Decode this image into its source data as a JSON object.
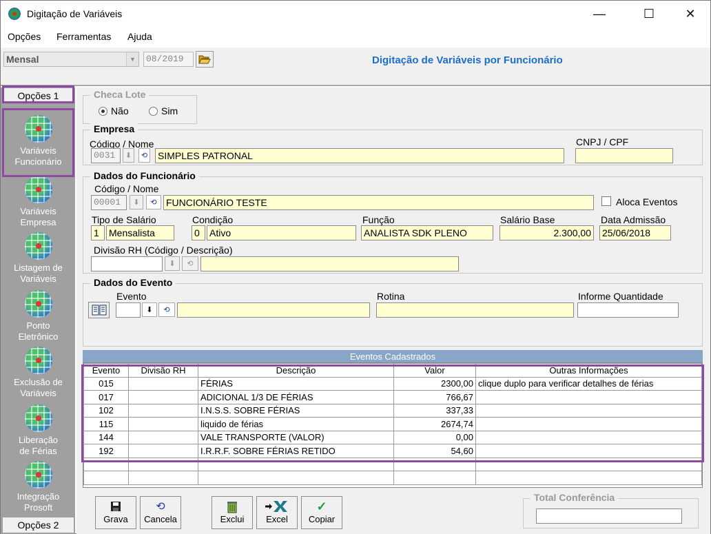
{
  "window": {
    "title": "Digitação de Variáveis",
    "minimize": "—",
    "maximize": "☐",
    "close": "✕"
  },
  "menu": [
    "Opções",
    "Ferramentas",
    "Ajuda"
  ],
  "toolbar": {
    "period": "Mensal",
    "date": "08/2019",
    "heading": "Digitação de Variáveis por Funcionário"
  },
  "sidebar": {
    "tab_top": "Opções 1",
    "tab_bottom": "Opções 2",
    "items": [
      {
        "l1": "Variáveis",
        "l2": "Funcionário"
      },
      {
        "l1": "Variáveis",
        "l2": "Empresa"
      },
      {
        "l1": "Listagem de",
        "l2": "Variáveis"
      },
      {
        "l1": "Ponto",
        "l2": "Eletrônico"
      },
      {
        "l1": "Exclusão de",
        "l2": "Variáveis"
      },
      {
        "l1": "Liberação",
        "l2": "de Férias"
      },
      {
        "l1": "Integração",
        "l2": "Prosoft"
      }
    ]
  },
  "checa_lote": {
    "title": "Checa Lote",
    "opt_nao": "Não",
    "opt_sim": "Sim"
  },
  "empresa": {
    "title": "Empresa",
    "codigo_label": "Código / Nome",
    "code": "0031",
    "name": "SIMPLES PATRONAL",
    "cnpj_label": "CNPJ / CPF",
    "cnpj": ""
  },
  "funcionario": {
    "title": "Dados do Funcionário",
    "codigo_label": "Código / Nome",
    "code": "00001",
    "name": "FUNCIONÁRIO TESTE",
    "aloca_label": "Aloca Eventos",
    "tipo_label": "Tipo de Salário",
    "tipo_code": "1",
    "tipo_text": "Mensalista",
    "cond_label": "Condição",
    "cond_code": "0",
    "cond_text": "Ativo",
    "funcao_label": "Função",
    "funcao": "ANALISTA SDK PLENO",
    "salario_label": "Salário Base",
    "salario": "2.300,00",
    "admissao_label": "Data Admissão",
    "admissao": "25/06/2018",
    "divisao_label": "Divisão RH (Código / Descrição)"
  },
  "evento": {
    "title": "Dados do Evento",
    "evento_label": "Evento",
    "rotina_label": "Rotina",
    "quantidade_label": "Informe Quantidade"
  },
  "grid": {
    "band": "Eventos Cadastrados",
    "headers": [
      "Evento",
      "Divisão RH",
      "Descrição",
      "Valor",
      "Outras Informações"
    ],
    "rows": [
      [
        "015",
        "",
        "FÉRIAS",
        "2300,00",
        "clique duplo para verificar detalhes de férias"
      ],
      [
        "017",
        "",
        "ADICIONAL 1/3 DE FÉRIAS",
        "766,67",
        ""
      ],
      [
        "102",
        "",
        "I.N.S.S. SOBRE FÉRIAS",
        "337,33",
        ""
      ],
      [
        "115",
        "",
        "liquido de férias",
        "2674,74",
        ""
      ],
      [
        "144",
        "",
        "VALE TRANSPORTE (VALOR)",
        "0,00",
        ""
      ],
      [
        "192",
        "",
        "I.R.R.F. SOBRE FÉRIAS RETIDO",
        "54,60",
        ""
      ]
    ]
  },
  "buttons": {
    "grava": "Grava",
    "cancela": "Cancela",
    "exclui": "Exclui",
    "excel": "Excel",
    "copiar": "Copiar"
  },
  "total": {
    "title": "Total Conferência",
    "value": ""
  },
  "colors": {
    "accent_title": "#1a6fc9",
    "highlight": "#8e4aa3",
    "field_yellow": "#ffffd2",
    "sidebar": "#a0a0a0"
  }
}
